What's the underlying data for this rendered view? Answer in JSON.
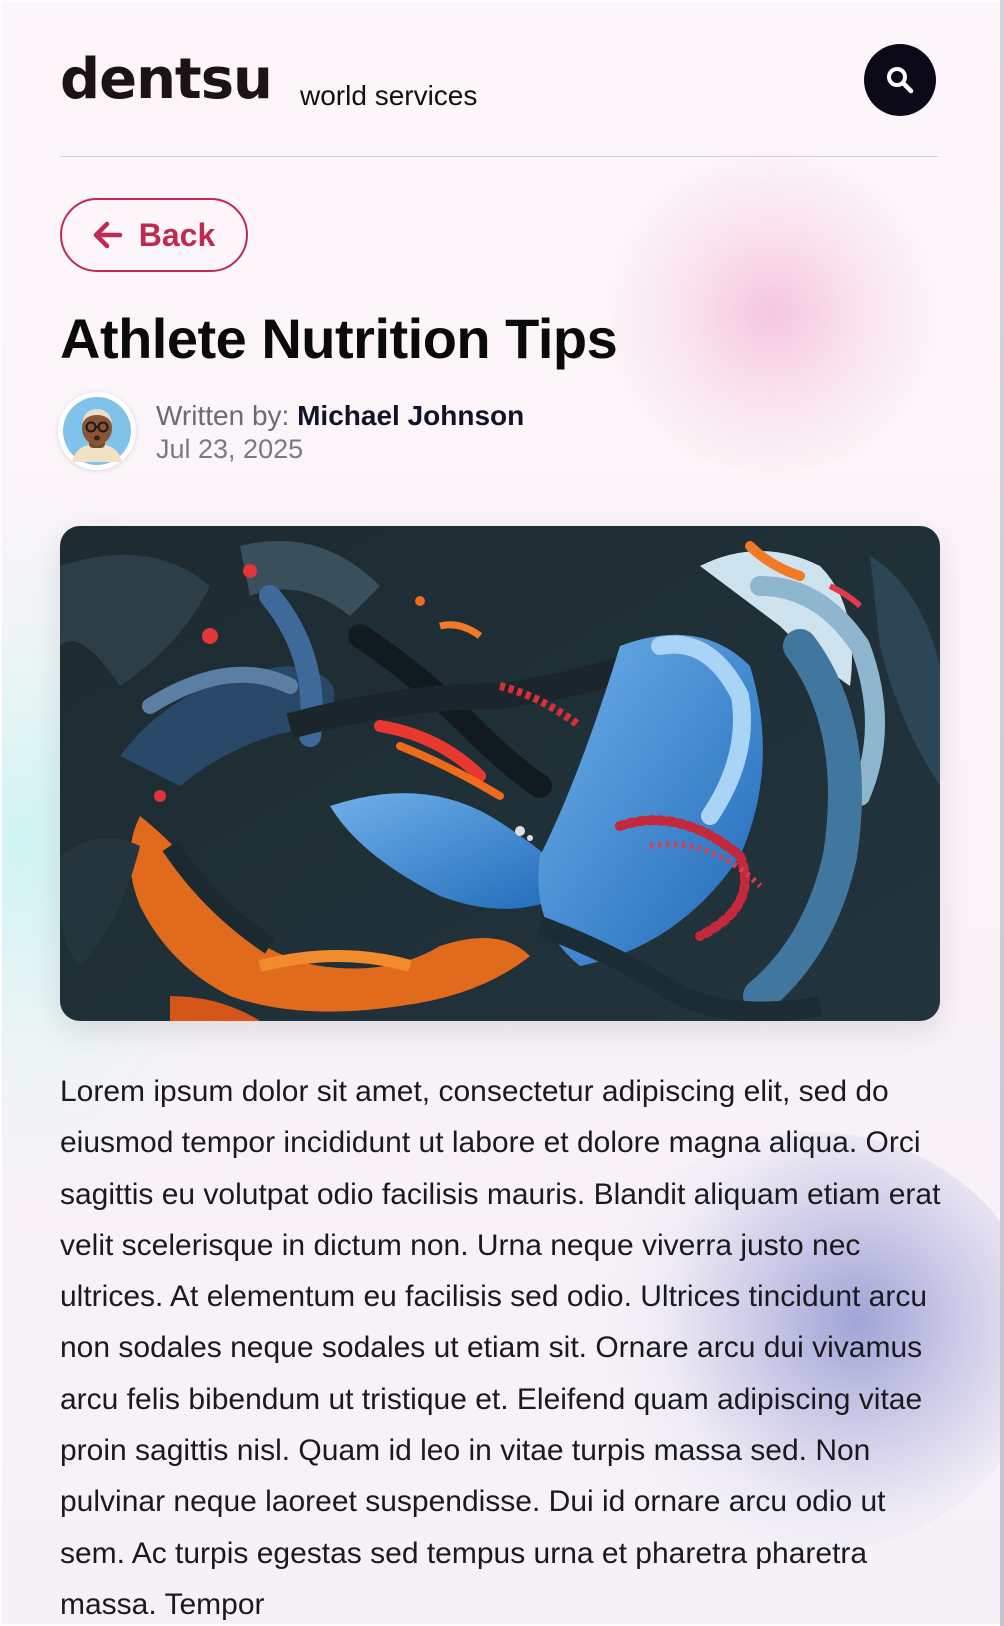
{
  "header": {
    "logo": "dentsu",
    "tagline": "world services",
    "search_icon": "search-icon"
  },
  "back_button": {
    "label": "Back",
    "icon": "arrow-left-icon"
  },
  "article": {
    "title": "Athlete Nutrition Tips",
    "byline_prefix": "Written by:",
    "author": "Michael Johnson",
    "date": "Jul 23, 2025",
    "hero_image": "abstract-painting-image",
    "body": "Lorem ipsum dolor sit amet, consectetur adipiscing elit, sed do eiusmod tempor incididunt ut labore et dolore magna aliqua. Orci sagittis eu volutpat odio facilisis mauris. Blandit aliquam etiam erat velit scelerisque in dictum non. Urna neque viverra justo nec ultrices. At elementum eu facilisis sed odio. Ultrices tincidunt arcu non sodales neque sodales ut etiam sit. Ornare arcu dui vivamus arcu felis bibendum ut tristique et. Eleifend quam adipiscing vitae proin sagittis nisl. Quam id leo in vitae turpis massa sed. Non pulvinar neque laoreet suspendisse. Dui id ornare arcu odio ut sem. Ac turpis egestas sed tempus urna et pharetra pharetra massa. Tempor"
  },
  "colors": {
    "accent": "#c02a50",
    "search_button_bg": "#0c0a18",
    "text": "#0a0a0a"
  }
}
